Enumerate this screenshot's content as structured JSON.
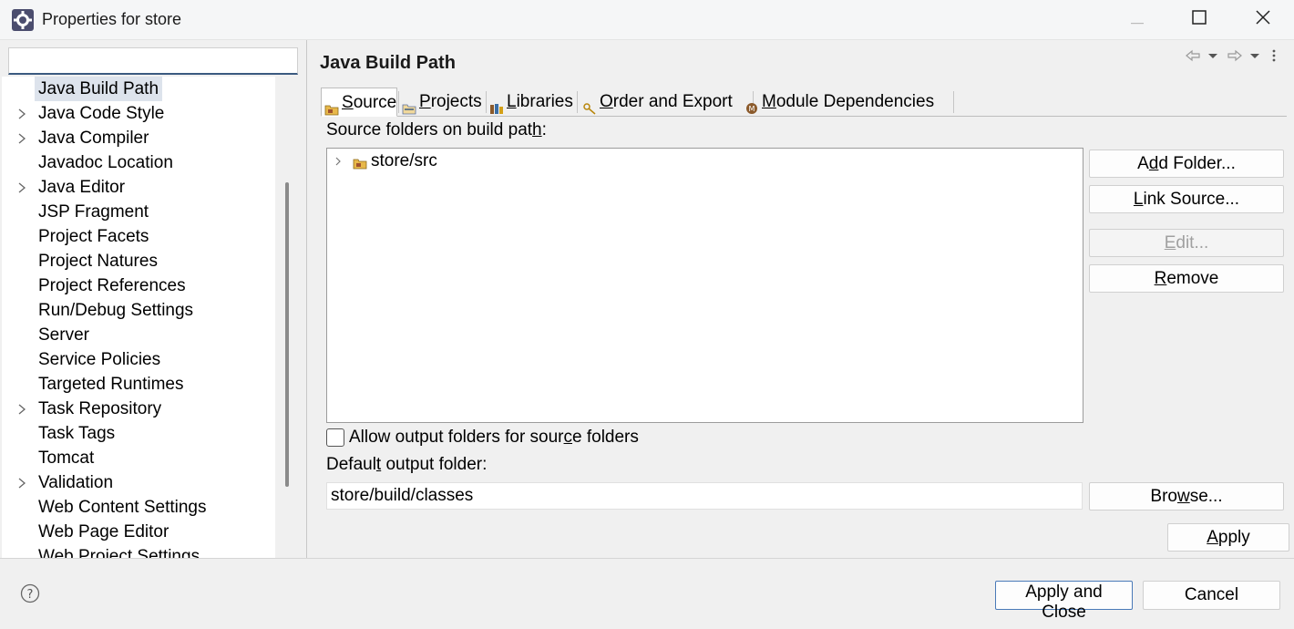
{
  "window": {
    "title": "Properties for store",
    "icons": {
      "app": "eclipse-gear-icon",
      "minimize": "minimize-icon",
      "maximize": "maximize-icon",
      "close": "close-icon"
    }
  },
  "sidebar": {
    "filter": {
      "value": "",
      "placeholder": ""
    },
    "items": [
      {
        "label": "Java Build Path",
        "expandable": false,
        "selected": true
      },
      {
        "label": "Java Code Style",
        "expandable": true
      },
      {
        "label": "Java Compiler",
        "expandable": true
      },
      {
        "label": "Javadoc Location",
        "expandable": false
      },
      {
        "label": "Java Editor",
        "expandable": true
      },
      {
        "label": "JSP Fragment",
        "expandable": false
      },
      {
        "label": "Project Facets",
        "expandable": false
      },
      {
        "label": "Project Natures",
        "expandable": false
      },
      {
        "label": "Project References",
        "expandable": false
      },
      {
        "label": "Run/Debug Settings",
        "expandable": false
      },
      {
        "label": "Server",
        "expandable": false
      },
      {
        "label": "Service Policies",
        "expandable": false
      },
      {
        "label": "Targeted Runtimes",
        "expandable": false
      },
      {
        "label": "Task Repository",
        "expandable": true
      },
      {
        "label": "Task Tags",
        "expandable": false
      },
      {
        "label": "Tomcat",
        "expandable": false
      },
      {
        "label": "Validation",
        "expandable": true
      },
      {
        "label": "Web Content Settings",
        "expandable": false
      },
      {
        "label": "Web Page Editor",
        "expandable": false
      },
      {
        "label": "Web Project Settings",
        "expandable": false
      }
    ]
  },
  "page": {
    "title": "Java Build Path",
    "nav_icons": [
      "back-arrow-icon",
      "dropdown-icon",
      "forward-arrow-icon",
      "dropdown-icon",
      "view-menu-icon"
    ],
    "tabs": [
      {
        "label_pre": "",
        "label_u": "S",
        "label_post": "ource",
        "icon": "source-folder-icon",
        "active": true
      },
      {
        "label_pre": "",
        "label_u": "P",
        "label_post": "rojects",
        "icon": "projects-icon",
        "active": false
      },
      {
        "label_pre": "",
        "label_u": "L",
        "label_post": "ibraries",
        "icon": "libraries-icon",
        "active": false
      },
      {
        "label_pre": "",
        "label_u": "O",
        "label_post": "rder and Export",
        "icon": "order-export-icon",
        "active": false
      },
      {
        "label_pre": "",
        "label_u": "M",
        "label_post": "odule Dependencies",
        "icon": "module-icon",
        "active": false
      }
    ],
    "source_label_pre": "Source folders on build pat",
    "source_label_u": "h",
    "source_label_post": ":",
    "source_folders": [
      {
        "path": "store/src",
        "icon": "package-folder-icon"
      }
    ],
    "buttons": {
      "add_folder": {
        "pre": "A",
        "u": "d",
        "post": "d Folder..."
      },
      "link_source": {
        "pre": "",
        "u": "L",
        "post": "ink Source..."
      },
      "edit": {
        "pre": "",
        "u": "E",
        "post": "dit..."
      },
      "remove": {
        "pre": "",
        "u": "R",
        "post": "emove"
      },
      "browse": {
        "pre": "Bro",
        "u": "w",
        "post": "se..."
      },
      "apply": {
        "pre": "",
        "u": "A",
        "post": "pply"
      }
    },
    "allow_output": {
      "pre": "Allow output folders for sour",
      "u": "c",
      "post": "e folders",
      "checked": false
    },
    "default_output_label": {
      "pre": "Defaul",
      "u": "t",
      "post": " output folder:"
    },
    "default_output_value": "store/build/classes"
  },
  "footer": {
    "help_icon": "help-icon",
    "apply_close": "Apply and Close",
    "cancel": "Cancel"
  },
  "colors": {
    "selection": "#dde3ec",
    "accent": "#3b5a80",
    "default_button_border": "#4a7ab8"
  }
}
